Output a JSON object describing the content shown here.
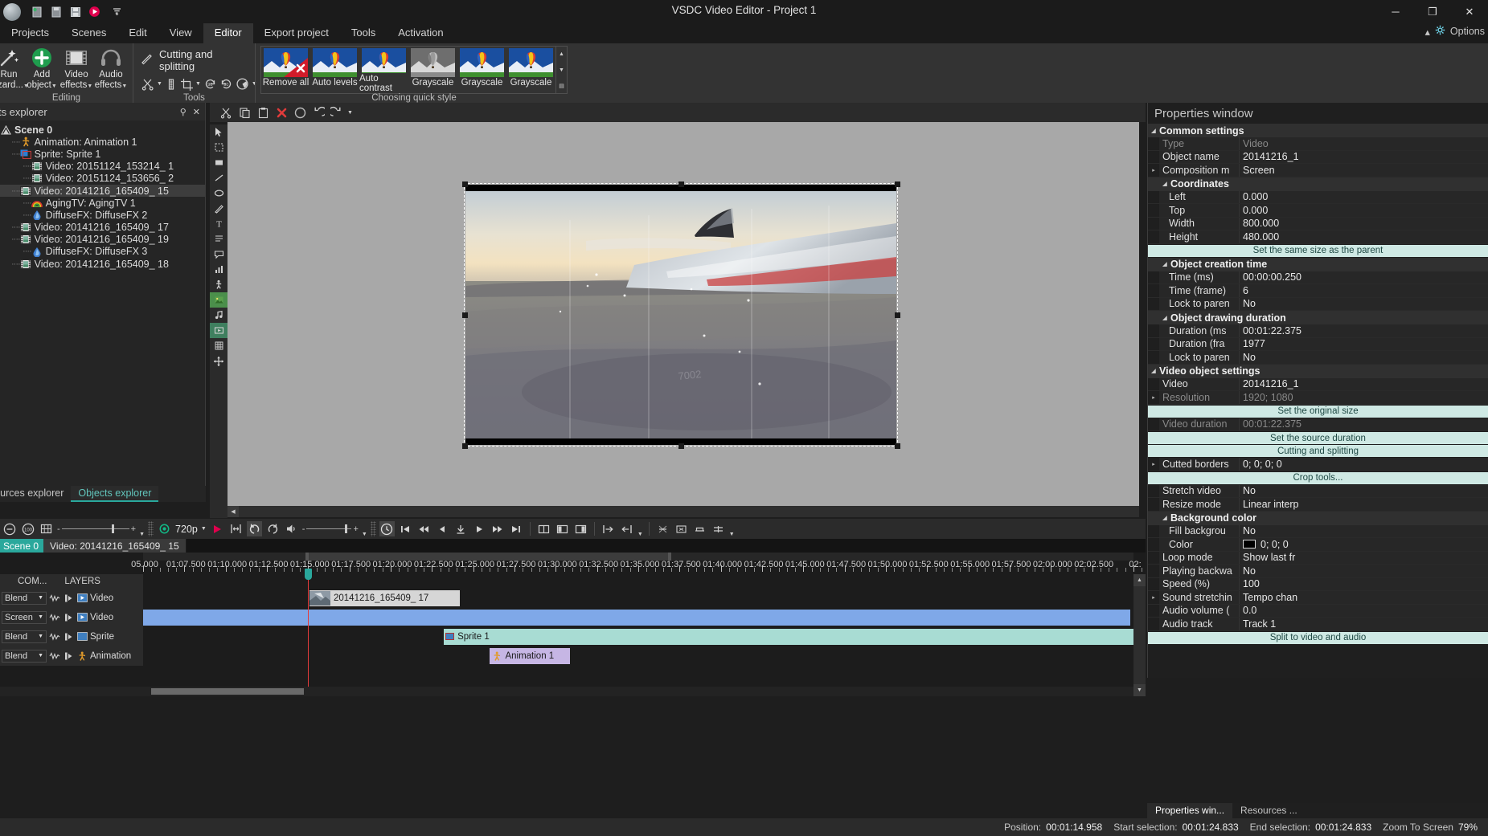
{
  "window": {
    "title": "VSDC Video Editor - Project 1",
    "quick_access": [
      "new-project-icon",
      "open-project-icon",
      "save-icon",
      "record-icon",
      "qat-dropdown-icon"
    ],
    "buttons": {
      "minimize": "─",
      "maximize": "❐",
      "close": "✕"
    }
  },
  "ribbon": {
    "tabs": [
      {
        "label": "Projects",
        "active": false
      },
      {
        "label": "Scenes",
        "active": false
      },
      {
        "label": "Edit",
        "active": false
      },
      {
        "label": "View",
        "active": false
      },
      {
        "label": "Editor",
        "active": true
      },
      {
        "label": "Export project",
        "active": false
      },
      {
        "label": "Tools",
        "active": false
      },
      {
        "label": "Activation",
        "active": false
      }
    ],
    "right_controls": {
      "help_label": "▴",
      "options_label": "Options"
    },
    "groups": [
      {
        "name": "editing",
        "label": "Editing"
      },
      {
        "name": "tools",
        "label": "Tools"
      },
      {
        "name": "quick_style",
        "label": "Choosing quick style"
      }
    ],
    "editing_buttons": [
      {
        "label_line1": "Run",
        "label_line2": "wizard...",
        "icon": "wand-icon",
        "has_caret": true
      },
      {
        "label_line1": "Add",
        "label_line2": "object",
        "icon": "add-object-icon",
        "has_caret": true
      },
      {
        "label_line1": "Video",
        "label_line2": "effects",
        "icon": "video-effects-icon",
        "has_caret": true
      },
      {
        "label_line1": "Audio",
        "label_line2": "effects",
        "icon": "audio-effects-icon",
        "has_caret": true
      }
    ],
    "tools_title": "Cutting and splitting",
    "tools_buttons": [
      "scissors-icon",
      "scissors-caret",
      "split-marker-icon",
      "crop-icon",
      "crop-caret",
      "rotate-left-90-icon",
      "rotate-right-90-icon",
      "effects-wheel-icon",
      "effects-wheel-caret"
    ],
    "quick_styles": [
      {
        "label": "Remove all",
        "thumb": "balloon-remove"
      },
      {
        "label": "Auto levels",
        "thumb": "balloon-color"
      },
      {
        "label": "Auto contrast",
        "thumb": "balloon-color"
      },
      {
        "label": "Grayscale",
        "thumb": "balloon-gray"
      },
      {
        "label": "Grayscale",
        "thumb": "balloon-color"
      },
      {
        "label": "Grayscale",
        "thumb": "balloon-color"
      }
    ]
  },
  "objects_explorer": {
    "title": "Objects explorer",
    "pin_icon": "pin-icon",
    "close_icon": "close-icon",
    "tree": [
      {
        "label": "Scene 0",
        "depth": 0,
        "icon": "scene-icon",
        "bold": true,
        "selected": false
      },
      {
        "label": "Animation: Animation 1",
        "depth": 1,
        "icon": "animation-icon",
        "bold": false,
        "selected": false
      },
      {
        "label": "Sprite: Sprite 1",
        "depth": 1,
        "icon": "sprite-icon",
        "bold": false,
        "selected": false
      },
      {
        "label": "Video: 20151124_153214_ 1",
        "depth": 2,
        "icon": "video-icon",
        "bold": false,
        "selected": false
      },
      {
        "label": "Video: 20151124_153656_ 2",
        "depth": 2,
        "icon": "video-icon",
        "bold": false,
        "selected": false
      },
      {
        "label": "Video: 20141216_165409_ 15",
        "depth": 1,
        "icon": "video-icon",
        "bold": false,
        "selected": true
      },
      {
        "label": "AgingTV: AgingTV 1",
        "depth": 2,
        "icon": "agingtv-icon",
        "bold": false,
        "selected": false
      },
      {
        "label": "DiffuseFX: DiffuseFX 2",
        "depth": 2,
        "icon": "diffusefx-icon",
        "bold": false,
        "selected": false
      },
      {
        "label": "Video: 20141216_165409_ 17",
        "depth": 1,
        "icon": "video-icon",
        "bold": false,
        "selected": false
      },
      {
        "label": "Video: 20141216_165409_ 19",
        "depth": 1,
        "icon": "video-icon",
        "bold": false,
        "selected": false
      },
      {
        "label": "DiffuseFX: DiffuseFX 3",
        "depth": 2,
        "icon": "diffusefx-icon",
        "bold": false,
        "selected": false
      },
      {
        "label": "Video: 20141216_165409_ 18",
        "depth": 1,
        "icon": "video-icon",
        "bold": false,
        "selected": false
      }
    ],
    "tabs": [
      {
        "label": "Resources explorer",
        "active": false
      },
      {
        "label": "Objects explorer",
        "active": true
      }
    ]
  },
  "scene_toolbar": [
    "cut-icon",
    "copy-icon",
    "paste-icon",
    "delete-icon",
    "stop-icon",
    "undo-icon",
    "redo-icon",
    "redo-caret"
  ],
  "tool_strip": [
    "cursor-icon",
    "hand-icon",
    "rect-select-icon",
    "line-icon",
    "ellipse-icon",
    "pen-icon",
    "text-icon",
    "subtitle-icon",
    "bubble-icon",
    "chart-icon",
    "sprite-tool-icon",
    "image-tool-icon",
    "audio-tool-icon",
    "video-tool-icon",
    "grid-icon",
    "move-icon"
  ],
  "player": {
    "zoom_out_icon": "zoom-out-icon",
    "zoom_100_icon": "zoom-100-icon",
    "fit_icon": "fit-to-screen-icon",
    "zoom_minus": "-",
    "zoom_plus": "+",
    "quality_label": "720p",
    "play_icon": "play-icon",
    "frame_icon": "frame-icon",
    "loop_icon": "loop-icon",
    "reset_icon": "reset-icon",
    "volume_icon": "volume-icon",
    "vol_minus": "-",
    "vol_plus": "+",
    "clock_icon": "clock-icon",
    "transport": [
      "skip-start-icon",
      "rewind-icon",
      "step-back-icon",
      "marker-icon",
      "play-transport-icon",
      "fast-forward-icon",
      "skip-end-icon"
    ],
    "extra": [
      "split-view-icon",
      "prev-marker-icon",
      "next-marker-icon",
      "start-sel-icon",
      "end-sel-icon",
      "seg-caret",
      "cut-seg-icon",
      "del-seg-icon",
      "trim-icon",
      "trim-caret"
    ]
  },
  "timeline": {
    "breadcrumb_scene": "Scene 0",
    "breadcrumb_object": "Video: 20141216_165409_ 15",
    "layers_header": "LAYERS",
    "common_header": "COM...",
    "ruler_start_sec": 64.0,
    "ruler_end_sec": 124.0,
    "ruler_labels": [
      "05.000",
      "01:07.500",
      "01:10.000",
      "01:12.500",
      "01:15.000",
      "01:17.500",
      "01:20.000",
      "01:22.500",
      "01:25.000",
      "01:27.500",
      "01:30.000",
      "01:32.500",
      "01:35.000",
      "01:37.500",
      "01:40.000",
      "01:42.500",
      "01:45.000",
      "01:47.500",
      "01:50.000",
      "01:52.500",
      "01:55.000",
      "01:57.500",
      "02:00.000",
      "02:02.500",
      "02:"
    ],
    "tracks": [
      {
        "blend": "Blend",
        "type_icon": "video-track-icon",
        "name": "Video",
        "clips": [
          {
            "label": "20141216_165409_ 17",
            "left_pct": 16.6,
            "width_pct": 15.0,
            "color": "#d6d6d6",
            "thumb": true
          }
        ]
      },
      {
        "blend": "Screen",
        "type_icon": "video-track-icon",
        "name": "Video",
        "clips": [
          {
            "label": "",
            "left_pct": 0.0,
            "width_pct": 98.5,
            "color": "#7fa8e8",
            "thumb": false
          }
        ]
      },
      {
        "blend": "Blend",
        "type_icon": "sprite-track-icon",
        "name": "Sprite",
        "clips": [
          {
            "label": "Sprite 1",
            "left_pct": 30.0,
            "width_pct": 69.5,
            "color": "#a8dcd3",
            "thumb": false
          }
        ]
      },
      {
        "blend": "Blend",
        "type_icon": "animation-track-icon",
        "name": "Animation",
        "clips": [
          {
            "label": "Animation 1",
            "left_pct": 34.6,
            "width_pct": 8.0,
            "color": "#c6b6e4",
            "thumb": false
          }
        ]
      }
    ],
    "playhead_pct": 16.6
  },
  "properties": {
    "title": "Properties window",
    "sections": [
      {
        "type": "group",
        "level": 1,
        "label": "Common settings"
      },
      {
        "type": "row",
        "key": "Type",
        "value": "Video",
        "disabled": true,
        "expandable": false
      },
      {
        "type": "row",
        "key": "Object name",
        "value": "20141216_1",
        "disabled": false,
        "expandable": false
      },
      {
        "type": "row",
        "key": "Composition m",
        "value": "Screen",
        "disabled": false,
        "expandable": true
      },
      {
        "type": "group",
        "level": 2,
        "label": "Coordinates"
      },
      {
        "type": "row",
        "key": "Left",
        "value": "0.000",
        "disabled": false,
        "expandable": false,
        "indent": 1
      },
      {
        "type": "row",
        "key": "Top",
        "value": "0.000",
        "disabled": false,
        "expandable": false,
        "indent": 1
      },
      {
        "type": "row",
        "key": "Width",
        "value": "800.000",
        "disabled": false,
        "expandable": false,
        "indent": 1
      },
      {
        "type": "row",
        "key": "Height",
        "value": "480.000",
        "disabled": false,
        "expandable": false,
        "indent": 1
      },
      {
        "type": "button",
        "label": "Set the same size as the parent"
      },
      {
        "type": "group",
        "level": 2,
        "label": "Object creation time"
      },
      {
        "type": "row",
        "key": "Time (ms)",
        "value": "00:00:00.250",
        "disabled": false,
        "expandable": false,
        "indent": 1
      },
      {
        "type": "row",
        "key": "Time (frame)",
        "value": "6",
        "disabled": false,
        "expandable": false,
        "indent": 1
      },
      {
        "type": "row",
        "key": "Lock to paren",
        "value": "No",
        "disabled": false,
        "expandable": false,
        "indent": 1
      },
      {
        "type": "group",
        "level": 2,
        "label": "Object drawing duration"
      },
      {
        "type": "row",
        "key": "Duration (ms",
        "value": "00:01:22.375",
        "disabled": false,
        "expandable": false,
        "indent": 1
      },
      {
        "type": "row",
        "key": "Duration (fra",
        "value": "1977",
        "disabled": false,
        "expandable": false,
        "indent": 1
      },
      {
        "type": "row",
        "key": "Lock to paren",
        "value": "No",
        "disabled": false,
        "expandable": false,
        "indent": 1
      },
      {
        "type": "group",
        "level": 1,
        "label": "Video object settings"
      },
      {
        "type": "row",
        "key": "Video",
        "value": "20141216_1",
        "disabled": false,
        "expandable": false
      },
      {
        "type": "row",
        "key": "Resolution",
        "value": "1920; 1080",
        "disabled": true,
        "expandable": true
      },
      {
        "type": "button",
        "label": "Set the original size"
      },
      {
        "type": "row",
        "key": "Video duration",
        "value": "00:01:22.375",
        "disabled": true,
        "expandable": false
      },
      {
        "type": "button",
        "label": "Set the source duration"
      },
      {
        "type": "button",
        "label": "Cutting and splitting"
      },
      {
        "type": "row",
        "key": "Cutted borders",
        "value": "0; 0; 0; 0",
        "disabled": false,
        "expandable": true
      },
      {
        "type": "button",
        "label": "Crop tools..."
      },
      {
        "type": "row",
        "key": "Stretch video",
        "value": "No",
        "disabled": false,
        "expandable": false
      },
      {
        "type": "row",
        "key": "Resize mode",
        "value": "Linear interp",
        "disabled": false,
        "expandable": false
      },
      {
        "type": "group",
        "level": 2,
        "label": "Background color"
      },
      {
        "type": "row",
        "key": "Fill backgrou",
        "value": "No",
        "disabled": false,
        "expandable": false,
        "indent": 1
      },
      {
        "type": "row",
        "key": "Color",
        "value": "0; 0; 0",
        "disabled": false,
        "expandable": false,
        "indent": 1,
        "swatch": "#000000"
      },
      {
        "type": "row",
        "key": "Loop mode",
        "value": "Show last fr",
        "disabled": false,
        "expandable": false
      },
      {
        "type": "row",
        "key": "Playing backwa",
        "value": "No",
        "disabled": false,
        "expandable": false
      },
      {
        "type": "row",
        "key": "Speed (%)",
        "value": "100",
        "disabled": false,
        "expandable": false
      },
      {
        "type": "row",
        "key": "Sound stretchin",
        "value": "Tempo chan",
        "disabled": false,
        "expandable": true
      },
      {
        "type": "row",
        "key": "Audio volume (",
        "value": "0.0",
        "disabled": false,
        "expandable": false
      },
      {
        "type": "row",
        "key": "Audio track",
        "value": "Track 1",
        "disabled": false,
        "expandable": false
      },
      {
        "type": "button",
        "label": "Split to video and audio"
      }
    ],
    "tabs": [
      {
        "label": "Properties win...",
        "active": true
      },
      {
        "label": "Resources ...",
        "active": false
      }
    ]
  },
  "status_bar": [
    {
      "key": "Position:",
      "value": "00:01:14.958"
    },
    {
      "key": "Start selection:",
      "value": "00:01:24.833"
    },
    {
      "key": "End selection:",
      "value": "00:01:24.833"
    },
    {
      "key": "Zoom To Screen",
      "value": "79%"
    }
  ]
}
